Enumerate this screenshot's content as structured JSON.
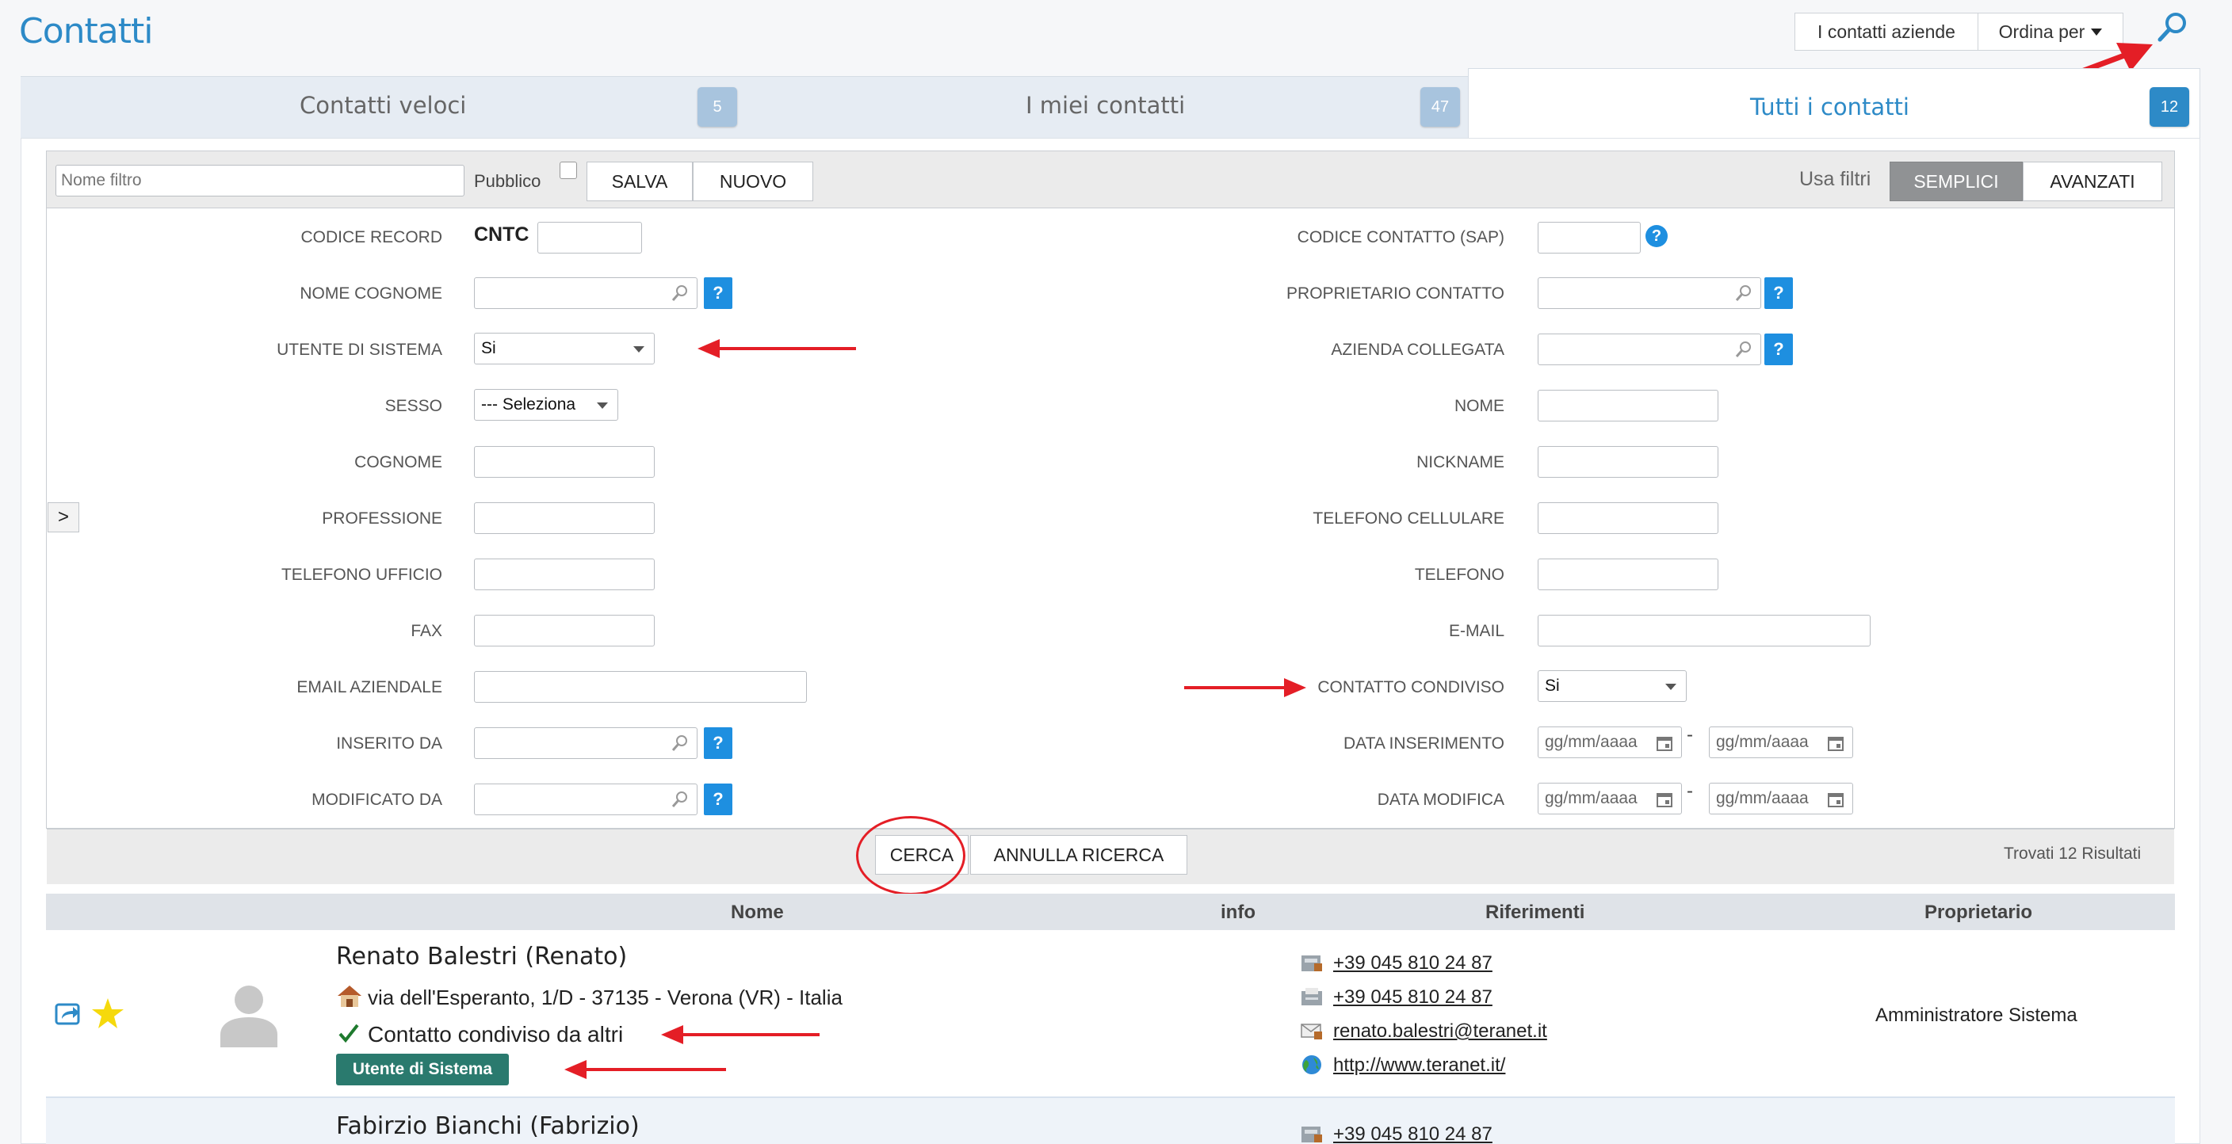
{
  "header": {
    "title": "Contatti",
    "btn_companies": "I contatti aziende",
    "btn_sort": "Ordina per"
  },
  "tabs": [
    {
      "label": "Contatti veloci",
      "count": "5"
    },
    {
      "label": "I miei contatti",
      "count": "47"
    },
    {
      "label": "Tutti i contatti",
      "count": "12"
    }
  ],
  "toolbar": {
    "filter_placeholder": "Nome filtro",
    "public_label": "Pubblico",
    "save": "SALVA",
    "new": "NUOVO",
    "use_filters": "Usa filtri",
    "simple": "SEMPLICI",
    "advanced": "AVANZATI"
  },
  "form": {
    "codice_record": "CODICE RECORD",
    "cntc": "CNTC",
    "nome_cognome": "NOME COGNOME",
    "utente_sistema": "UTENTE DI SISTEMA",
    "utente_sistema_value": "Si",
    "sesso": "SESSO",
    "sesso_value": "--- Seleziona",
    "cognome": "COGNOME",
    "professione": "PROFESSIONE",
    "tel_ufficio": "TELEFONO UFFICIO",
    "fax": "FAX",
    "email_aziendale": "EMAIL AZIENDALE",
    "inserito_da": "INSERITO DA",
    "modificato_da": "MODIFICATO DA",
    "codice_sap": "CODICE CONTATTO (SAP)",
    "proprietario": "PROPRIETARIO CONTATTO",
    "azienda": "AZIENDA COLLEGATA",
    "nome": "NOME",
    "nickname": "NICKNAME",
    "tel_cell": "TELEFONO CELLULARE",
    "telefono": "TELEFONO",
    "email": "E-MAIL",
    "condiviso": "CONTATTO CONDIVISO",
    "condiviso_value": "Si",
    "data_ins": "DATA INSERIMENTO",
    "data_mod": "DATA MODIFICA",
    "date_placeholder": "gg/mm/aaaa",
    "dash": "-",
    "help": "?",
    "expand": ">"
  },
  "footer": {
    "search": "CERCA",
    "cancel": "ANNULLA RICERCA",
    "results": "Trovati 12 Risultati"
  },
  "table": {
    "headers": [
      "Nome",
      "info",
      "Riferimenti",
      "Proprietario"
    ],
    "rows": [
      {
        "name": "Renato Balestri (Renato)",
        "address": "via dell'Esperanto, 1/D - 37135 - Verona (VR) - Italia",
        "shared": "Contatto condiviso da altri",
        "badge": "Utente di Sistema",
        "phone1": "+39 045 810 24 87",
        "phone2": "+39 045 810 24 87",
        "email": "renato.balestri@teranet.it",
        "web": "http://www.teranet.it/",
        "owner": "Amministratore Sistema"
      },
      {
        "name": "Fabirzio Bianchi (Fabrizio)",
        "phone1": "+39 045 810 24 87"
      }
    ]
  },
  "colors": {
    "accent": "#2d8ac7",
    "help_blue": "#1e8fe0",
    "badge_green": "#2a7a6e",
    "annotation_red": "#e41e26"
  }
}
